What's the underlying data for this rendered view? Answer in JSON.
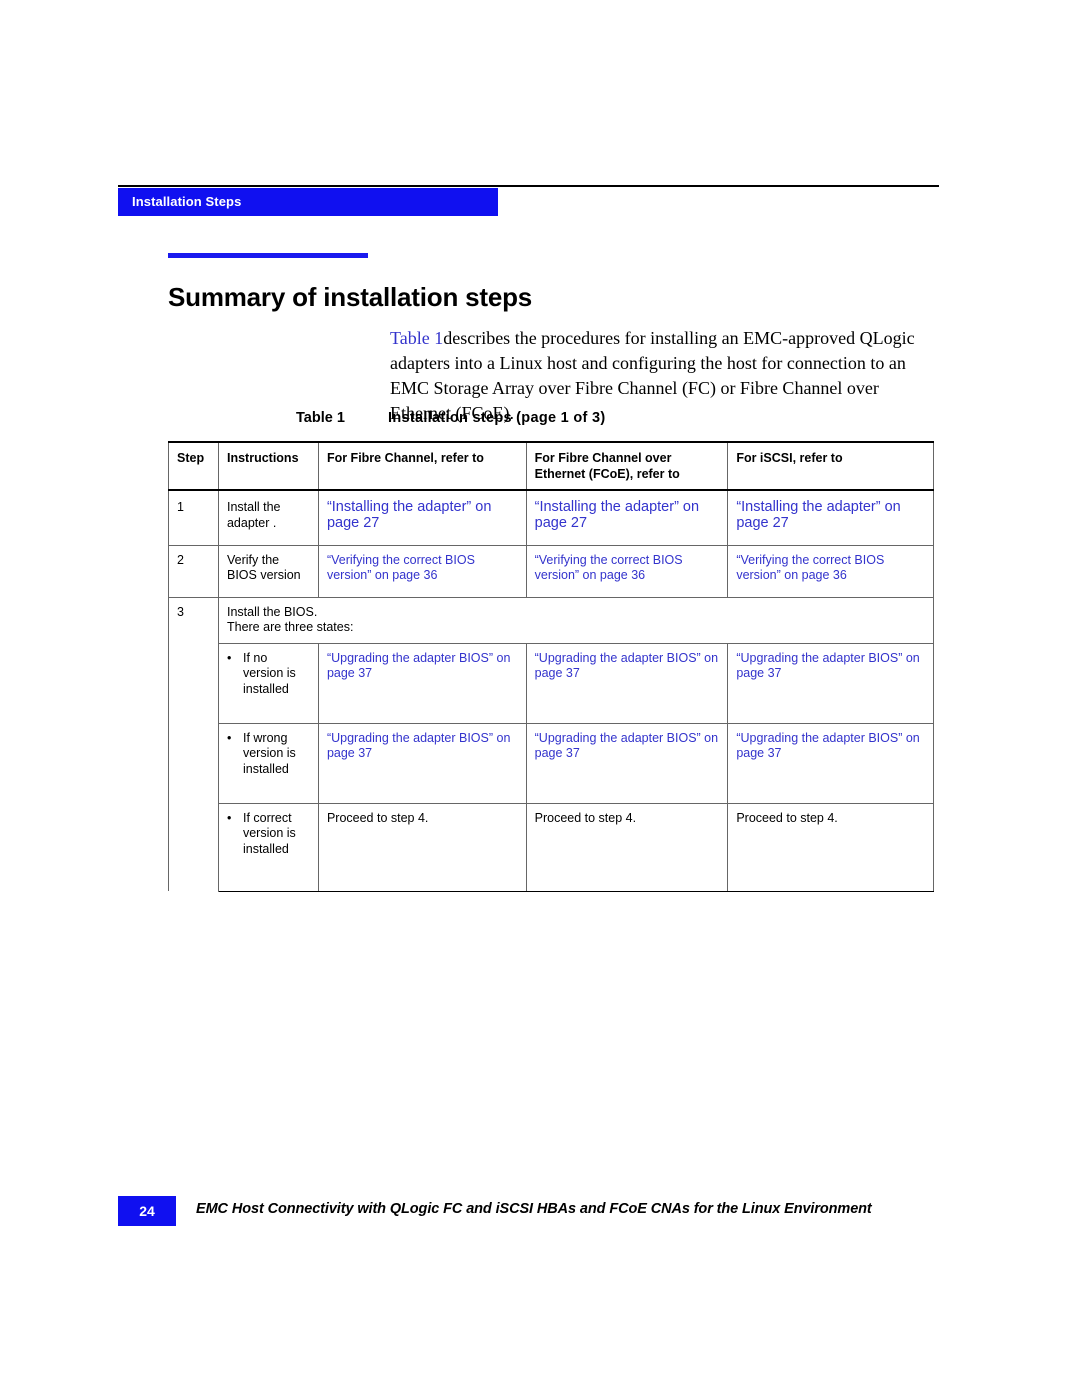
{
  "colors": {
    "brand_blue": "#1010f0",
    "rule_blue": "#1a1aee",
    "link_blue": "#3333cc",
    "text_black": "#000000"
  },
  "header": {
    "running_head": "Installation Steps"
  },
  "section": {
    "title": "Summary of installation steps"
  },
  "intro": {
    "xref": "Table 1",
    "body": "describes the procedures for installing an EMC-approved QLogic adapters into a Linux host and configuring the host for connection to an EMC Storage Array over Fibre Channel (FC) or Fibre Channel over Ethernet (FCoE)."
  },
  "table_caption": {
    "number": "Table 1",
    "text": "Installation steps  (page 1 of 3)"
  },
  "table": {
    "columns": [
      "Step",
      "Instructions",
      "For Fibre Channel, refer to",
      "For Fibre Channel over Ethernet (FCoE), refer to",
      "For iSCSI, refer to"
    ],
    "rows": [
      {
        "step": "1",
        "instructions": "Install the adapter .",
        "fc": "“Installing the adapter” on page 27",
        "fcoe": "“Installing the adapter” on page 27",
        "iscsi": "“Installing the adapter” on page 27"
      },
      {
        "step": "2",
        "instructions": "Verify the BIOS version",
        "fc": "“Verifying the correct BIOS version” on page 36",
        "fcoe": "“Verifying the correct BIOS version” on page 36",
        "iscsi": "“Verifying the correct BIOS version” on page 36"
      }
    ],
    "step3": {
      "step": "3",
      "intro_line1": "Install the BIOS.",
      "intro_line2": "There are three states:",
      "substeps": [
        {
          "bullet": "•",
          "condition": "If no version is installed",
          "fc": "“Upgrading the adapter BIOS” on page 37",
          "fcoe": "“Upgrading the adapter BIOS” on page 37",
          "iscsi": "“Upgrading the adapter BIOS” on page 37"
        },
        {
          "bullet": "•",
          "condition": "If wrong version is installed",
          "fc": "“Upgrading the adapter BIOS” on page 37",
          "fcoe": "“Upgrading the adapter BIOS” on page 37",
          "iscsi": "“Upgrading the adapter BIOS” on page 37"
        },
        {
          "bullet": "•",
          "condition": "If correct version is installed",
          "fc": "Proceed to step 4.",
          "fcoe": "Proceed to step 4.",
          "iscsi": "Proceed to step 4."
        }
      ]
    }
  },
  "footer": {
    "page_number": "24",
    "book_title": "EMC Host Connectivity with QLogic FC and iSCSI HBAs and FCoE CNAs for the Linux Environment"
  }
}
